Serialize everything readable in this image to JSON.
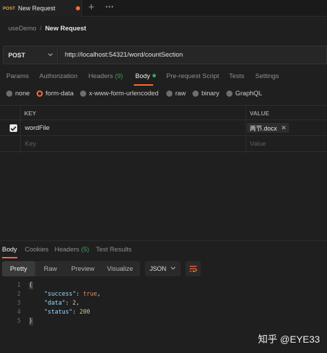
{
  "tab": {
    "method": "POST",
    "title": "New Request"
  },
  "breadcrumb": {
    "parent": "useDemo",
    "separator": "/",
    "current": "New Request"
  },
  "request": {
    "method": "POST",
    "url": "http://localhost:54321/word/countSection"
  },
  "request_tabs": [
    {
      "label": "Params"
    },
    {
      "label": "Authorization"
    },
    {
      "label": "Headers",
      "count": "(9)"
    },
    {
      "label": "Body"
    },
    {
      "label": "Pre-request Script"
    },
    {
      "label": "Tests"
    },
    {
      "label": "Settings"
    }
  ],
  "body_types": [
    "none",
    "form-data",
    "x-www-form-urlencoded",
    "raw",
    "binary",
    "GraphQL"
  ],
  "body_type_selected": "form-data",
  "form_table": {
    "headers": {
      "key": "KEY",
      "value": "VALUE"
    },
    "rows": [
      {
        "checked": true,
        "key": "wordFile",
        "value": "两节.docx"
      }
    ],
    "placeholder": {
      "key": "Key",
      "value": "Value"
    }
  },
  "response_tabs": [
    {
      "label": "Body"
    },
    {
      "label": "Cookies"
    },
    {
      "label": "Headers",
      "count": "(5)"
    },
    {
      "label": "Test Results"
    }
  ],
  "format_options": [
    "Pretty",
    "Raw",
    "Preview",
    "Visualize"
  ],
  "format_selected": "Pretty",
  "language": "JSON",
  "response_lines": {
    "numbers": [
      "1",
      "2",
      "3",
      "4",
      "5"
    ],
    "open": "{",
    "close": "}",
    "fields": [
      {
        "key": "\"success\"",
        "value": "true",
        "trail": ","
      },
      {
        "key": "\"data\"",
        "value": "2",
        "trail": ","
      },
      {
        "key": "\"status\"",
        "value": "200",
        "trail": ""
      }
    ]
  },
  "watermark": "知乎 @EYE33",
  "colors": {
    "accent": "#ff6c37",
    "count_green": "#3ca55c",
    "method_orange": "#e8a84a"
  }
}
